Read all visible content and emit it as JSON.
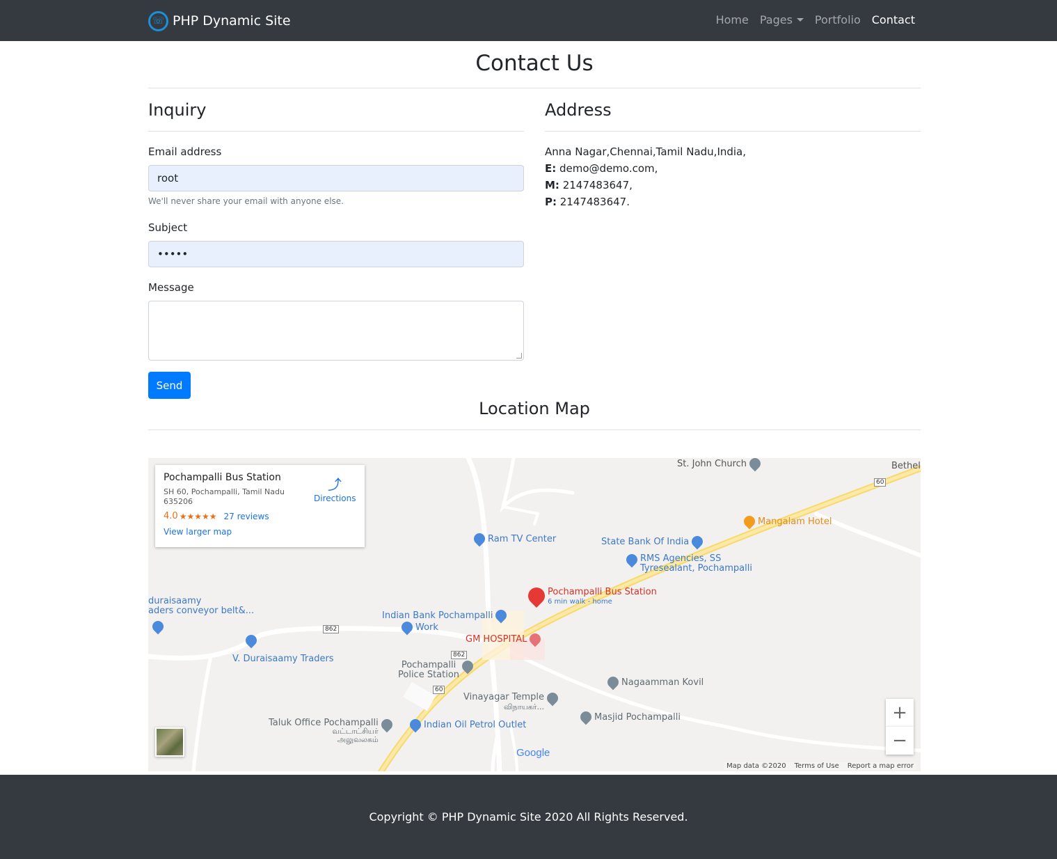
{
  "brand": {
    "name": "PHP Dynamic Site"
  },
  "nav": {
    "home": "Home",
    "pages": "Pages",
    "portfolio": "Portfolio",
    "contact": "Contact"
  },
  "page": {
    "title": "Contact Us"
  },
  "inquiry": {
    "title": "Inquiry",
    "email_label": "Email address",
    "email_value": "root",
    "email_help": "We'll never share your email with anyone else.",
    "subject_label": "Subject",
    "subject_value": "•••••",
    "message_label": "Message",
    "message_value": "",
    "send_label": "Send"
  },
  "address": {
    "title": "Address",
    "street": "Anna Nagar,Chennai,Tamil Nadu,India,",
    "email_key": "E:",
    "email_val": " demo@demo.com,",
    "mobile_key": "M:",
    "mobile_val": " 2147483647,",
    "phone_key": "P:",
    "phone_val": " 2147483647."
  },
  "location": {
    "title": "Location Map"
  },
  "map": {
    "card_title": "Pochampalli Bus Station",
    "card_address": "SH 60, Pochampalli, Tamil Nadu 635206",
    "rating": "4.0",
    "stars": "★★★★★",
    "reviews": "27 reviews",
    "larger_map": "View larger map",
    "directions": "Directions",
    "places": {
      "st_john": "St. John Church",
      "bethel": "Bethel",
      "mangalam": "Mangalam Hotel",
      "ram_tv": "Ram TV Center",
      "sbi": "State Bank Of India",
      "rms1": "RMS Agencies, SS",
      "rms2": "Tyresealant, Pochampalli",
      "bus_station": "Pochampalli Bus Station",
      "bus_sub": "6 min walk - home",
      "duraisaamy1": "duraisaamy",
      "duraisaamy2": "aders conveyor belt&...",
      "indian_bank": "Indian Bank Pochampalli",
      "work": "Work",
      "gm_hospital": "GM HOSPITAL",
      "duraisaamy_traders": "V. Duraisaamy Traders",
      "police1": "Pochampalli",
      "police2": "Police Station",
      "nagaamman": "Nagaamman Kovil",
      "vinayagar1": "Vinayagar Temple",
      "vinayagar2": "விநாயகர்...",
      "masjid": "Masjid Pochampalli",
      "taluk1": "Taluk Office Pochampalli",
      "taluk2": "வட்டாட்சியர்",
      "taluk3": "அலுவலகம்",
      "ioc": "Indian Oil Petrol Outlet"
    },
    "shields": {
      "s862a": "862",
      "s862b": "862",
      "s60a": "60",
      "s60b": "60"
    },
    "zoom_in": "+",
    "zoom_out": "−",
    "google": "Google",
    "map_data": "Map data ©2020",
    "terms": "Terms of Use",
    "report": "Report a map error"
  },
  "footer": {
    "text": "Copyright © PHP Dynamic Site 2020 All Rights Reserved."
  },
  "colors": {
    "navbar": "#343a40",
    "primary": "#007bff",
    "autofill": "#e8f0fe",
    "road_major": "#fbe08c"
  }
}
